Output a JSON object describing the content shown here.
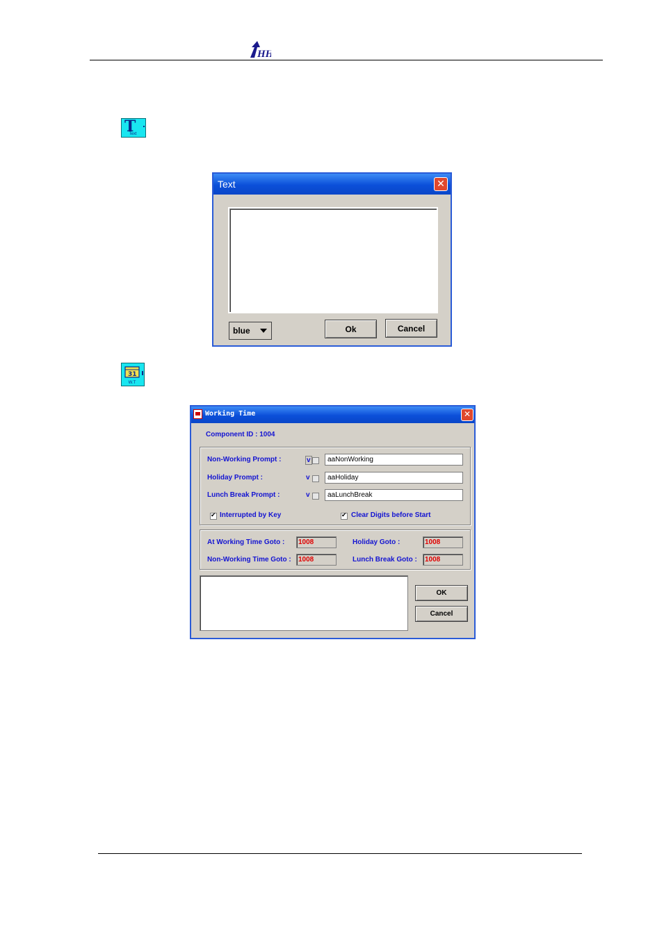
{
  "page": {
    "logo_text": "HH"
  },
  "icons": {
    "text_tool": {
      "glyph": "T",
      "caption": "Text"
    },
    "working_time_tool": {
      "caption": "W.T"
    }
  },
  "text_dialog": {
    "title": "Text",
    "close_glyph": "✕",
    "content_value": "",
    "color_value": "blue",
    "ok_label": "Ok",
    "cancel_label": "Cancel"
  },
  "working_time_dialog": {
    "title": "Working Time",
    "close_glyph": "✕",
    "component_id": "Component ID : 1004",
    "prompts": [
      {
        "label": "Non-Working Prompt :",
        "v": "v",
        "value": "aaNonWorking"
      },
      {
        "label": "Holiday Prompt :",
        "v": "v",
        "value": "aaHoliday"
      },
      {
        "label": "Lunch Break Prompt :",
        "v": "v",
        "value": "aaLunchBreak"
      }
    ],
    "interrupted_by_key": {
      "label": "Interrupted by Key",
      "checked": true
    },
    "clear_digits": {
      "label": "Clear Digits before Start",
      "checked": true
    },
    "gotos": {
      "at_working_label": "At Working Time Goto :",
      "at_working_value": "1008",
      "holiday_label": "Holiday Goto :",
      "holiday_value": "1008",
      "non_working_label": "Non-Working Time Goto :",
      "non_working_value": "1008",
      "lunch_label": "Lunch Break Goto :",
      "lunch_value": "1008"
    },
    "memo_value": "",
    "ok_label": "OK",
    "cancel_label": "Cancel"
  },
  "colors": {
    "title_bar": "#0b4fd9",
    "dialog_bg": "#d4d0c8",
    "label_blue": "#1414d2",
    "goto_red": "#e00000",
    "icon_cyan": "#19e6f0"
  }
}
